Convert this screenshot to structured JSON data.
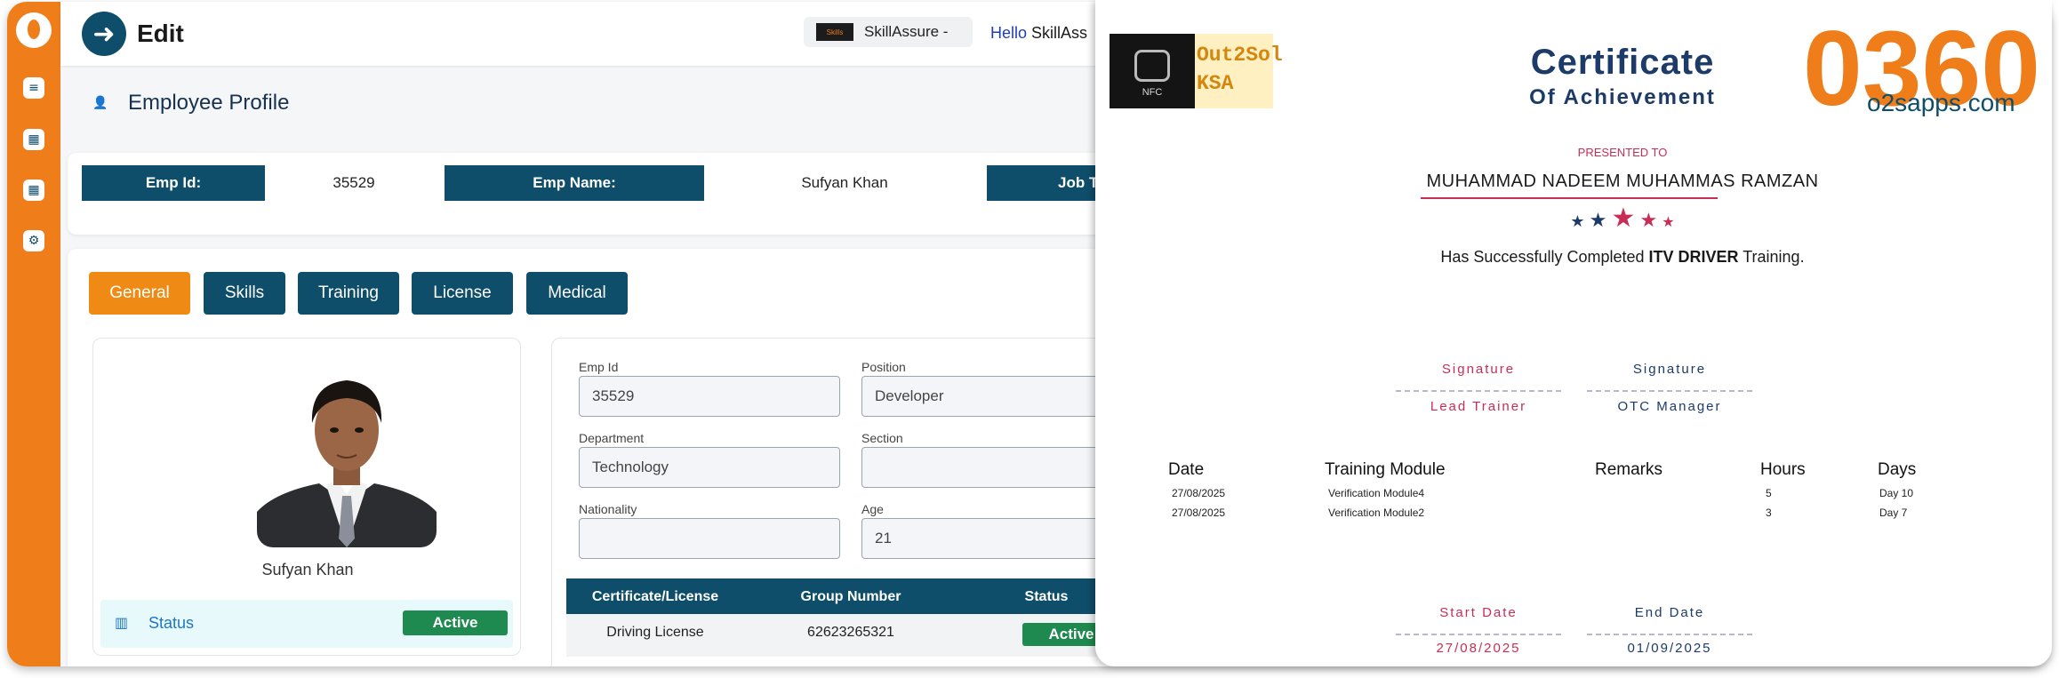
{
  "app": {
    "title": "Edit",
    "org_name": "SkillAssure -",
    "org_logo_text": "Skills",
    "hello": "Hello",
    "hello_user": "SkillAss"
  },
  "sidebar": {
    "items": [
      {
        "icon": "menu-icon",
        "glyph": "≡"
      },
      {
        "icon": "grid-icon",
        "glyph": "▦"
      },
      {
        "icon": "table-icon",
        "glyph": "▦"
      },
      {
        "icon": "gear-icon",
        "glyph": "⚙"
      }
    ]
  },
  "page": {
    "title": "Employee Profile"
  },
  "header_fields": {
    "emp_id_label": "Emp Id:",
    "emp_id_value": "35529",
    "emp_name_label": "Emp Name:",
    "emp_name_value": "Sufyan Khan",
    "job_label": "Job T"
  },
  "tabs": [
    "General",
    "Skills",
    "Training",
    "License",
    "Medical"
  ],
  "profile_card": {
    "name": "Sufyan Khan",
    "status_label": "Status",
    "status_value": "Active"
  },
  "form": {
    "emp_id_label": "Emp Id",
    "emp_id_value": "35529",
    "position_label": "Position",
    "position_value": "Developer",
    "department_label": "Department",
    "department_value": "Technology",
    "section_label": "Section",
    "section_value": "",
    "nationality_label": "Nationality",
    "nationality_value": "",
    "age_label": "Age",
    "age_value": "21"
  },
  "license_table": {
    "headers": [
      "Certificate/License",
      "Group Number",
      "Status"
    ],
    "rows": [
      {
        "name": "Driving License",
        "group": "62623265321",
        "status": "Active"
      }
    ]
  },
  "certificate": {
    "nfc_text": "NFC",
    "brand_line1": "Out2Sol",
    "brand_line2": "KSA",
    "logo_text": "0360",
    "logo_url": "o2sapps.com",
    "title": "Certificate",
    "subtitle": "Of Achievement",
    "presented_to": "PRESENTED TO",
    "recipient": "MUHAMMAD NADEEM MUHAMMAS RAMZAN",
    "completed_prefix": "Has Successfully Completed ",
    "completed_course": "ITV DRIVER",
    "completed_suffix": " Training.",
    "signature_left": "Signature",
    "signature_left_role": "Lead Trainer",
    "signature_right": "Signature",
    "signature_right_role": "OTC Manager",
    "modules_headers": [
      "Date",
      "Training Module",
      "Remarks",
      "Hours",
      "Days"
    ],
    "modules": [
      {
        "date": "27/08/2025",
        "module": "Verification Module4",
        "remarks": "",
        "hours": "5",
        "days": "Day 10"
      },
      {
        "date": "27/08/2025",
        "module": "Verification Module2",
        "remarks": "",
        "hours": "3",
        "days": "Day 7"
      }
    ],
    "start_label": "Start Date",
    "start_value": "27/08/2025",
    "end_label": "End Date",
    "end_value": "01/09/2025"
  },
  "colors": {
    "accent_orange": "#ef7d1a",
    "brand_navy": "#0e4e6a",
    "active_green": "#1e8a4f",
    "cert_red": "#c72e55",
    "cert_navy": "#1c3b68"
  }
}
